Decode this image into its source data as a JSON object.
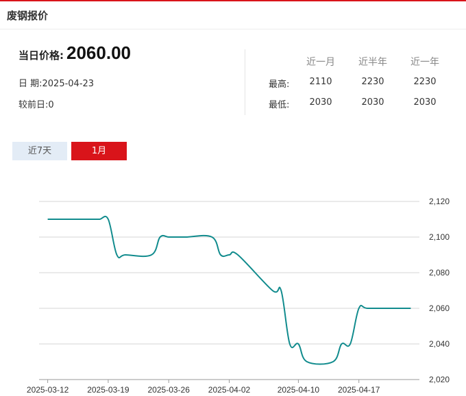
{
  "header": {
    "title": "废钢报价"
  },
  "info": {
    "price_label": "当日价格:",
    "price_value": "2060.00",
    "date_label": "日 期:",
    "date_value": "2025-04-23",
    "change_label": "较前日:",
    "change_value": "0"
  },
  "stats": {
    "headers": [
      "近一月",
      "近半年",
      "近一年"
    ],
    "rows": [
      {
        "label": "最高:",
        "values": [
          "2110",
          "2230",
          "2230"
        ]
      },
      {
        "label": "最低:",
        "values": [
          "2030",
          "2030",
          "2030"
        ]
      }
    ]
  },
  "tabs": [
    {
      "label": "近7天",
      "active": false
    },
    {
      "label": "1月",
      "active": true
    }
  ],
  "colors": {
    "accent": "#d9141a",
    "line": "#108b8d",
    "tab_inactive": "#e3ecf6"
  },
  "chart_data": {
    "type": "line",
    "title": "",
    "xlabel": "",
    "ylabel": "",
    "ylim": [
      2020,
      2120
    ],
    "yticks": [
      2020,
      2040,
      2060,
      2080,
      2100,
      2120
    ],
    "ytick_labels": [
      "2,020",
      "2,040",
      "2,060",
      "2,080",
      "2,100",
      "2,120"
    ],
    "xtick_labels": [
      "2025-03-12",
      "2025-03-19",
      "2025-03-26",
      "2025-04-02",
      "2025-04-10",
      "2025-04-17"
    ],
    "grid": true,
    "series": [
      {
        "x": [
          "2025-03-12",
          "2025-03-13",
          "2025-03-14",
          "2025-03-17",
          "2025-03-18",
          "2025-03-19",
          "2025-03-20",
          "2025-03-21",
          "2025-03-24",
          "2025-03-25",
          "2025-03-26",
          "2025-03-27",
          "2025-03-28",
          "2025-03-31",
          "2025-04-01",
          "2025-04-02",
          "2025-04-03",
          "2025-04-07",
          "2025-04-08",
          "2025-04-09",
          "2025-04-10",
          "2025-04-11",
          "2025-04-14",
          "2025-04-15",
          "2025-04-16",
          "2025-04-17",
          "2025-04-18",
          "2025-04-21",
          "2025-04-22",
          "2025-04-23"
        ],
        "values": [
          2110,
          2110,
          2110,
          2110,
          2110,
          2110,
          2090,
          2090,
          2090,
          2100,
          2100,
          2100,
          2100,
          2100,
          2090,
          2090,
          2090,
          2070,
          2070,
          2040,
          2040,
          2030,
          2030,
          2040,
          2040,
          2060,
          2060,
          2060,
          2060,
          2060
        ]
      }
    ]
  }
}
